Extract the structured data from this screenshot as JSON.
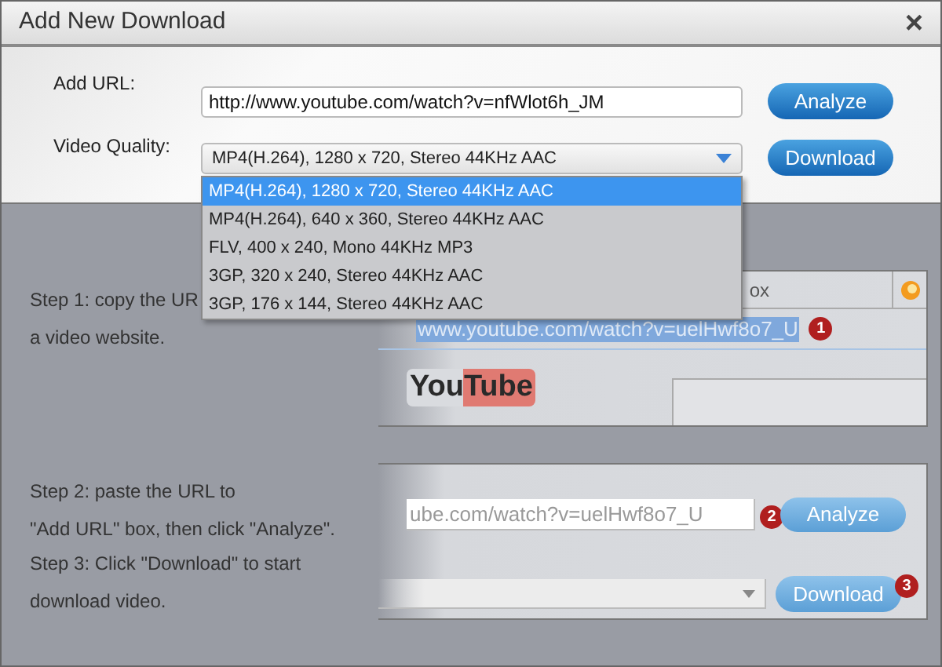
{
  "window": {
    "title": "Add New Download",
    "close": "×"
  },
  "form": {
    "url_label": "Add URL:",
    "url_value": "http://www.youtube.com/watch?v=nfWlot6h_JM",
    "analyze_button": "Analyze",
    "quality_label": "Video Quality:",
    "quality_value": "MP4(H.264), 1280 x 720, Stereo 44KHz AAC",
    "download_button": "Download",
    "quality_options": [
      {
        "label": "MP4(H.264), 1280 x 720, Stereo 44KHz AAC",
        "selected": true
      },
      {
        "label": "MP4(H.264), 640 x 360, Stereo 44KHz AAC",
        "selected": false
      },
      {
        "label": "FLV, 400 x 240, Mono 44KHz MP3",
        "selected": false
      },
      {
        "label": "3GP, 320 x 240, Stereo 44KHz AAC",
        "selected": false
      },
      {
        "label": "3GP, 176 x 144, Stereo 44KHz AAC",
        "selected": false
      }
    ]
  },
  "instructions": {
    "step_1": [
      "Step 1: copy the UR",
      "a video website."
    ],
    "step_2": [
      "Step 2: paste the URL to",
      "\"Add URL\" box, then click \"Analyze\"."
    ],
    "step_3": [
      "Step 3: Click \"Download\" to start",
      "download video."
    ]
  },
  "browser_illustration": {
    "tab_text": "ox",
    "address": "www.youtube.com/watch?v=uelHwf8o7_U",
    "badge": "1",
    "logo": "YouTube"
  },
  "app_illustration": {
    "url": "ube.com/watch?v=uelHwf8o7_U",
    "badge_2": "2",
    "analyze_button": "Analyze",
    "download_button": "Download",
    "badge_3": "3"
  }
}
